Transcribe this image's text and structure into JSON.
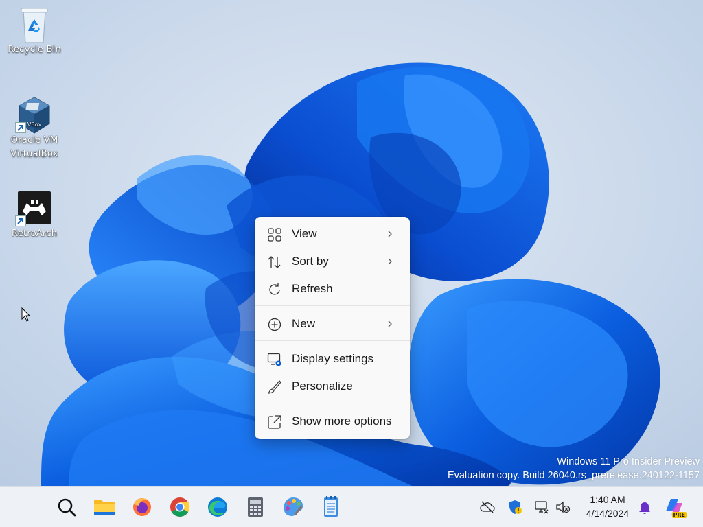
{
  "desktop": {
    "icons": [
      {
        "label": "Recycle Bin",
        "icon": "recycle-bin-icon"
      },
      {
        "label": "Oracle VM VirtualBox",
        "label_line1": "Oracle VM",
        "label_line2": "VirtualBox",
        "icon": "virtualbox-icon"
      },
      {
        "label": "RetroArch",
        "icon": "retroarch-icon"
      }
    ]
  },
  "context_menu": {
    "items": [
      {
        "label": "View",
        "icon": "view-grid-icon",
        "has_submenu": true
      },
      {
        "label": "Sort by",
        "icon": "sort-icon",
        "has_submenu": true
      },
      {
        "label": "Refresh",
        "icon": "refresh-icon",
        "has_submenu": false
      },
      {
        "label": "New",
        "icon": "new-plus-icon",
        "has_submenu": true
      },
      {
        "label": "Display settings",
        "icon": "display-settings-icon",
        "has_submenu": false
      },
      {
        "label": "Personalize",
        "icon": "personalize-brush-icon",
        "has_submenu": false
      },
      {
        "label": "Show more options",
        "icon": "show-more-options-icon",
        "has_submenu": false
      }
    ]
  },
  "watermark": {
    "line1": "Windows 11 Pro Insider Preview",
    "line2": "Evaluation copy. Build 26040.rs_prerelease.240122-1157"
  },
  "taskbar": {
    "apps": [
      "search-icon",
      "file-explorer-icon",
      "firefox-icon",
      "chrome-icon",
      "edge-icon",
      "calculator-icon",
      "paint-icon",
      "notepad-icon"
    ],
    "tray": [
      "onedrive-cloud-icon",
      "defender-security-icon",
      "network-icon",
      "volume-muted-icon"
    ],
    "clock": {
      "time": "1:40 AM",
      "date": "4/14/2024"
    },
    "copilot_badge": "PRE"
  },
  "colors": {
    "accent": "#0a5bd6",
    "menu_bg": "#f9f9f9",
    "taskbar_bg": "#eef1f6"
  }
}
